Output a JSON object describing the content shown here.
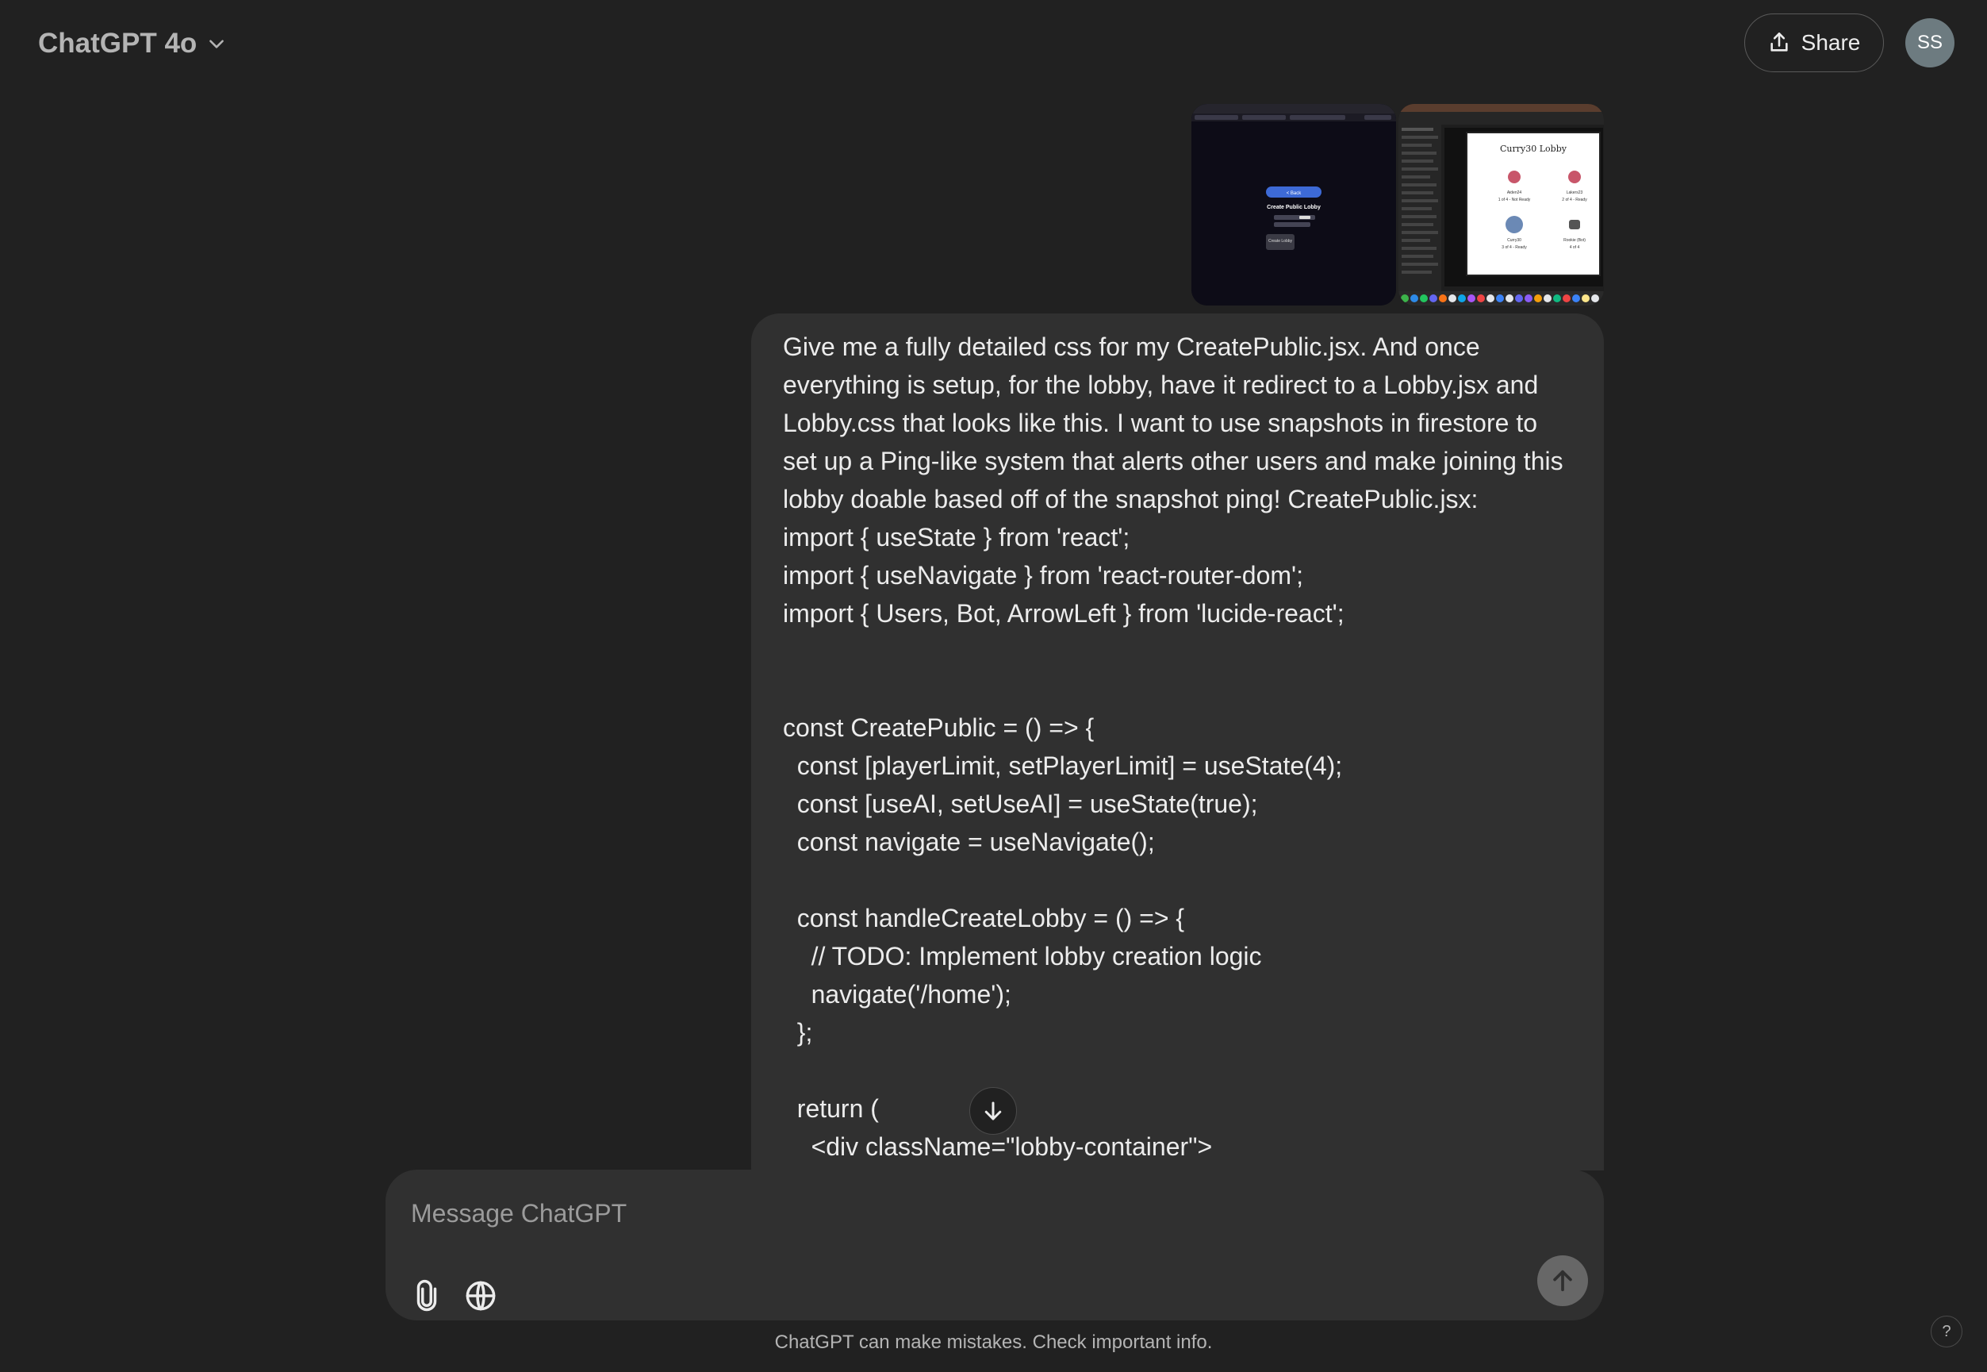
{
  "header": {
    "model_name": "ChatGPT 4o",
    "share_label": "Share",
    "avatar_initials": "SS"
  },
  "attachments": [
    {
      "id": "screenshot-create-public-lobby",
      "button_label": "< Back",
      "title": "Create Public Lobby",
      "create_label": "Create Lobby"
    },
    {
      "id": "screenshot-lobby",
      "title": "Curry30 Lobby",
      "players": [
        {
          "name": "Aiden24",
          "status": "1 of 4 - Not Ready"
        },
        {
          "name": "Lakers23",
          "status": "2 of 4 - Ready"
        },
        {
          "name": "Curry30",
          "status": "3 of 4 - Ready"
        },
        {
          "name": "Rookie (Bot)",
          "status": "4 of 4"
        }
      ]
    }
  ],
  "message": {
    "text": "Give me a fully detailed css for my CreatePublic.jsx. And once everything is setup, for the lobby, have it redirect to a Lobby.jsx and Lobby.css that looks like this. I want to use snapshots in firestore to set up a Ping-like system that alerts other users and make joining this lobby doable based off of the snapshot ping! CreatePublic.jsx:\nimport { useState } from 'react';\nimport { useNavigate } from 'react-router-dom';\nimport { Users, Bot, ArrowLeft } from 'lucide-react';\n\n\nconst CreatePublic = () => {\n  const [playerLimit, setPlayerLimit] = useState(4);\n  const [useAI, setUseAI] = useState(true);\n  const navigate = useNavigate();\n\n  const handleCreateLobby = () => {\n    // TODO: Implement lobby creation logic\n    navigate('/home');\n  };\n\n  return (\n    <div className=\"lobby-container\">"
  },
  "composer": {
    "placeholder": "Message ChatGPT"
  },
  "icons": [
    "chevron-down-icon",
    "share-icon",
    "arrow-down-icon",
    "paperclip-icon",
    "globe-icon",
    "arrow-up-icon"
  ],
  "footer": {
    "disclaimer": "ChatGPT can make mistakes. Check important info.",
    "help_label": "?"
  }
}
